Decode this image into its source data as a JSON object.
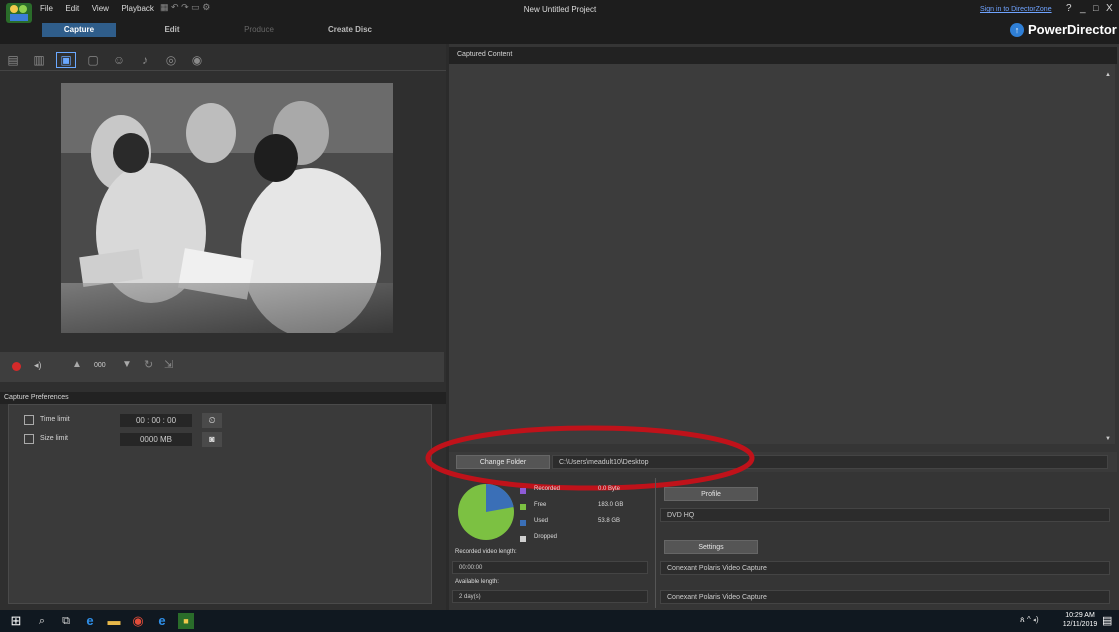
{
  "window": {
    "title": "New Untitled Project",
    "sign_in": "Sign in to DirectorZone",
    "help": "?",
    "minimize": "_",
    "restore": "□",
    "close": "X",
    "brand": "PowerDirector"
  },
  "menu": {
    "items": [
      "File",
      "Edit",
      "View",
      "Playback"
    ]
  },
  "tabs": {
    "capture": "Capture",
    "edit": "Edit",
    "produce": "Produce",
    "create_disc": "Create Disc"
  },
  "capture_transport": {
    "counter": "000"
  },
  "capture_preferences": {
    "title": "Capture Preferences",
    "time_limit_label": "Time limit",
    "time_limit_value": "00 : 00 : 00",
    "size_limit_label": "Size limit",
    "size_limit_value": "0000   MB"
  },
  "captured_content": {
    "title": "Captured Content"
  },
  "folder": {
    "button": "Change Folder",
    "path": "C:\\Users\\meadult10\\Desktop"
  },
  "disk": {
    "legend": [
      {
        "label": "Recorded",
        "value": "0.0 Byte",
        "color": "#8e5bd6"
      },
      {
        "label": "Free",
        "value": "183.0 GB",
        "color": "#7cc142"
      },
      {
        "label": "Used",
        "value": "53.8 GB",
        "color": "#3a6fb7"
      },
      {
        "label": "Dropped",
        "value": "",
        "color": "#cfcfcf"
      }
    ],
    "recorded_length_label": "Recorded video length:",
    "recorded_length_value": "00:00:00",
    "available_length_label": "Available length:",
    "available_length_value": "2 day(s)"
  },
  "profile": {
    "button": "Profile",
    "value": "DVD HQ"
  },
  "settings": {
    "button": "Settings",
    "device1": "Conexant Polaris Video Capture",
    "device2": "Conexant Polaris Video Capture"
  },
  "taskbar": {
    "time": "10:29 AM",
    "date": "12/11/2019"
  },
  "colors": {
    "accent_tab": "#2f5d8a",
    "annotation_circle": "#c0121a"
  }
}
